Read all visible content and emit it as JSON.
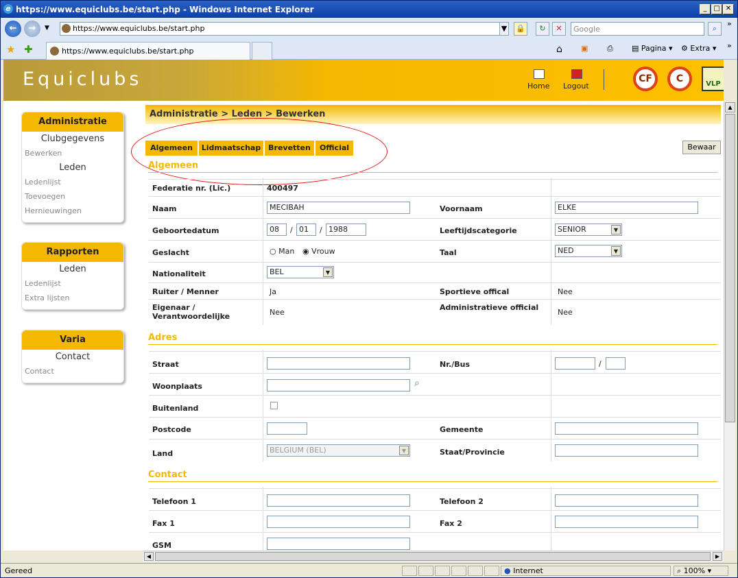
{
  "window": {
    "title": "https://www.equiclubs.be/start.php - Windows Internet Explorer"
  },
  "browser": {
    "url": "https://www.equiclubs.be/start.php",
    "search_placeholder": "Google",
    "tab_title": "https://www.equiclubs.be/start.php",
    "commands": [
      "Pagina",
      "Extra"
    ]
  },
  "site": {
    "logo": "Equiclubs",
    "home": "Home",
    "logout": "Logout",
    "vli": "VLP"
  },
  "sidebar": [
    {
      "head": "Administratie",
      "items": [
        {
          "type": "sub",
          "label": "Clubgegevens"
        },
        {
          "type": "link",
          "label": "Bewerken"
        },
        {
          "type": "sub",
          "label": "Leden"
        },
        {
          "type": "link",
          "label": "Ledenlijst"
        },
        {
          "type": "link",
          "label": "Toevoegen"
        },
        {
          "type": "link",
          "label": "Hernieuwingen"
        }
      ]
    },
    {
      "head": "Rapporten",
      "items": [
        {
          "type": "sub",
          "label": "Leden"
        },
        {
          "type": "link",
          "label": "Ledenlijst"
        },
        {
          "type": "link",
          "label": "Extra lijsten"
        }
      ]
    },
    {
      "head": "Varia",
      "items": [
        {
          "type": "sub",
          "label": "Contact"
        },
        {
          "type": "link",
          "label": "Contact"
        }
      ]
    }
  ],
  "breadcrumb": "Administratie > Leden > Bewerken",
  "tabs": [
    "Algemeen",
    "Lidmaatschap",
    "Brevetten",
    "Official"
  ],
  "save_label": "Bewaar",
  "sections": {
    "algemeen": "Algemeen",
    "adres": "Adres",
    "contact": "Contact"
  },
  "form": {
    "federatie_label": "Federatie nr. (Lic.)",
    "federatie_value": "400497",
    "naam_label": "Naam",
    "naam_value": "MECIBAH",
    "voornaam_label": "Voornaam",
    "voornaam_value": "ELKE",
    "geboortedatum_label": "Geboortedatum",
    "geb_dag": "08",
    "geb_maand": "01",
    "geb_jaar": "1988",
    "leeftijd_label": "Leeftijdscategorie",
    "leeftijd_value": "SENIOR",
    "geslacht_label": "Geslacht",
    "geslacht_man": "Man",
    "geslacht_vrouw": "Vrouw",
    "taal_label": "Taal",
    "taal_value": "NED",
    "nationaliteit_label": "Nationaliteit",
    "nationaliteit_value": "BEL",
    "ruiter_label": "Ruiter / Menner",
    "ruiter_value": "Ja",
    "sportieve_label": "Sportieve offical",
    "sportieve_value": "Nee",
    "eigenaar_label1": "Eigenaar /",
    "eigenaar_label2": "Verantwoordelijke",
    "eigenaar_value": "Nee",
    "admin_label": "Administratieve official",
    "admin_value": "Nee",
    "straat_label": "Straat",
    "nrbus_label": "Nr./Bus",
    "woonplaats_label": "Woonplaats",
    "buitenland_label": "Buitenland",
    "postcode_label": "Postcode",
    "gemeente_label": "Gemeente",
    "land_label": "Land",
    "land_value": "BELGIUM (BEL)",
    "staat_label": "Staat/Provincie",
    "tel1_label": "Telefoon 1",
    "tel2_label": "Telefoon 2",
    "fax1_label": "Fax 1",
    "fax2_label": "Fax 2",
    "gsm_label": "GSM"
  },
  "status": {
    "left": "Gereed",
    "zone": "Internet",
    "zoom": "100%"
  }
}
